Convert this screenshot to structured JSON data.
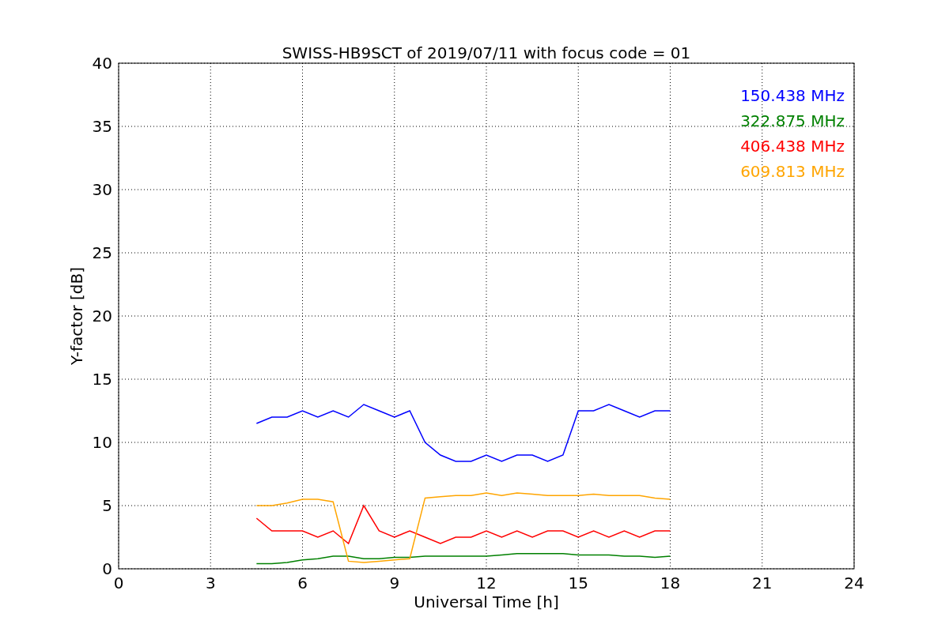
{
  "chart": {
    "chart_data": {
      "type": "line",
      "title": "SWISS-HB9SCT of 2019/07/11 with focus code = 01",
      "xlabel": "Universal Time [h]",
      "ylabel": "Y-factor [dB]",
      "x": [
        4.5,
        5,
        5.5,
        6,
        6.5,
        7,
        7.5,
        8,
        8.5,
        9,
        9.5,
        10,
        10.5,
        11,
        11.5,
        12,
        12.5,
        13,
        13.5,
        14,
        14.5,
        15,
        15.5,
        16,
        16.5,
        17,
        17.5,
        18
      ],
      "series": [
        {
          "name": "150.438 MHz",
          "color": "#0000ff",
          "values": [
            11.5,
            12,
            12,
            12.5,
            12,
            12.5,
            12,
            13,
            12.5,
            12,
            12.5,
            10,
            9,
            8.5,
            8.5,
            9,
            8.5,
            9,
            9,
            8.5,
            9,
            12.5,
            12.5,
            13,
            12.5,
            12,
            12.5,
            12.5
          ]
        },
        {
          "name": "322.875 MHz",
          "color": "#008000",
          "values": [
            0.4,
            0.4,
            0.5,
            0.7,
            0.8,
            1,
            1,
            0.8,
            0.8,
            0.9,
            0.9,
            1,
            1,
            1,
            1,
            1,
            1.1,
            1.2,
            1.2,
            1.2,
            1.2,
            1.1,
            1.1,
            1.1,
            1,
            1,
            0.9,
            1
          ]
        },
        {
          "name": "406.438 MHz",
          "color": "#ff0000",
          "values": [
            4,
            3,
            3,
            3,
            2.5,
            3,
            2,
            5,
            3,
            2.5,
            3,
            2.5,
            2,
            2.5,
            2.5,
            3,
            2.5,
            3,
            2.5,
            3,
            3,
            2.5,
            3,
            2.5,
            3,
            2.5,
            3,
            3
          ]
        },
        {
          "name": "609.813 MHz",
          "color": "#ffa500",
          "values": [
            5,
            5,
            5.2,
            5.5,
            5.5,
            5.3,
            0.6,
            0.5,
            0.6,
            0.7,
            0.8,
            5.6,
            5.7,
            5.8,
            5.8,
            6,
            5.8,
            6,
            5.9,
            5.8,
            5.8,
            5.8,
            5.9,
            5.8,
            5.8,
            5.8,
            5.6,
            5.5
          ]
        }
      ],
      "grid": true,
      "xlim": [
        0,
        24
      ],
      "ylim": [
        0,
        40
      ],
      "xticks": [
        0,
        3,
        6,
        9,
        12,
        15,
        18,
        21,
        24
      ],
      "yticks": [
        0,
        5,
        10,
        15,
        20,
        25,
        30,
        35,
        40
      ]
    }
  }
}
